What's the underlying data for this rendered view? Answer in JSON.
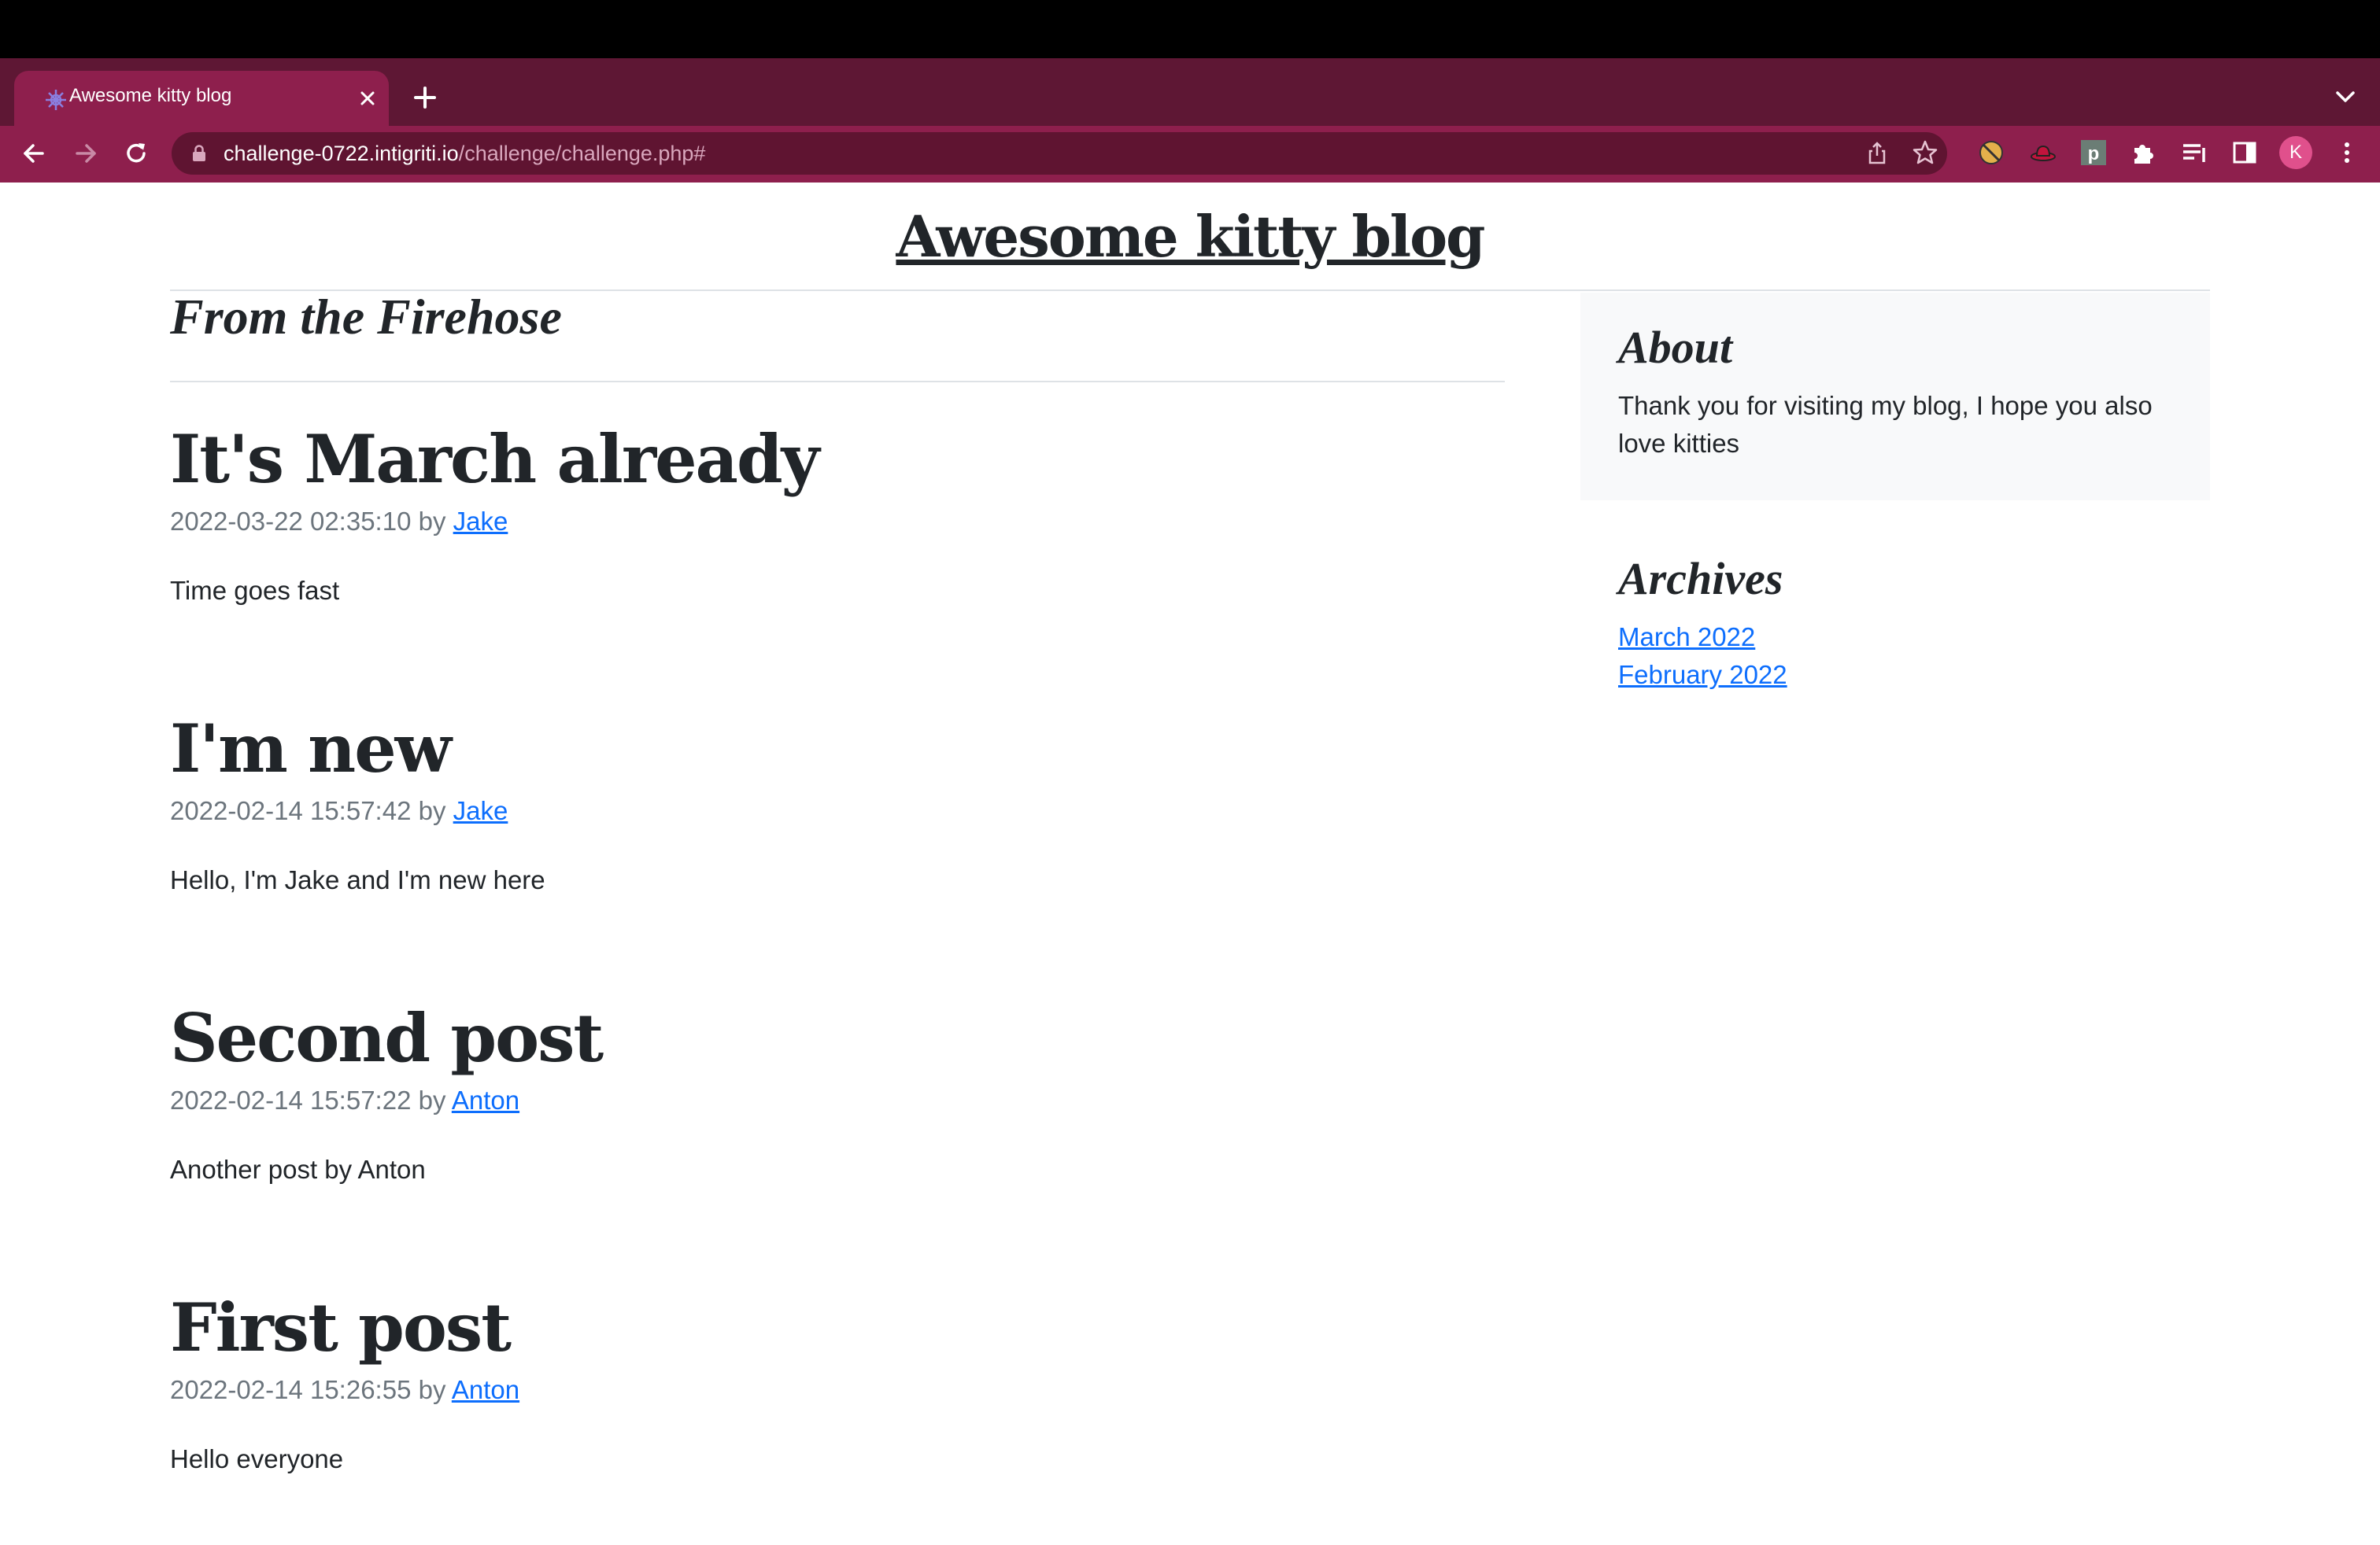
{
  "browser": {
    "tab_title": "Awesome kitty blog",
    "url_host": "challenge-0722.intigriti.io",
    "url_path": "/challenge/challenge.php#",
    "profile_initial": "K",
    "extensions": [
      "privacy-badger-icon",
      "hat-extension-icon",
      "p-extension-icon",
      "puzzle-extensions-icon"
    ],
    "colors": {
      "tabstrip": "#5e1734",
      "toolbar": "#8e1f4d",
      "omnibox": "#5f1431",
      "avatar": "#e0508c"
    }
  },
  "page": {
    "blog_title": "Awesome kitty blog",
    "section_heading": "From the Firehose",
    "posts": [
      {
        "title": "It's March already",
        "date": "2022-03-22 02:35:10",
        "by": "by",
        "author": "Jake",
        "body": "Time goes fast"
      },
      {
        "title": "I'm new",
        "date": "2022-02-14 15:57:42",
        "by": "by",
        "author": "Jake",
        "body": "Hello, I'm Jake and I'm new here"
      },
      {
        "title": "Second post",
        "date": "2022-02-14 15:57:22",
        "by": "by",
        "author": "Anton",
        "body": "Another post by Anton"
      },
      {
        "title": "First post",
        "date": "2022-02-14 15:26:55",
        "by": "by",
        "author": "Anton",
        "body": "Hello everyone"
      }
    ],
    "sidebar": {
      "about_heading": "About",
      "about_text": "Thank you for visiting my blog, I hope you also love kitties",
      "archives_heading": "Archives",
      "archives": [
        "March 2022",
        "February 2022"
      ]
    },
    "colors": {
      "link": "#0d6efd",
      "text": "#212529",
      "muted": "#6c757d",
      "sidebar_bg": "#f8f9fa"
    }
  }
}
